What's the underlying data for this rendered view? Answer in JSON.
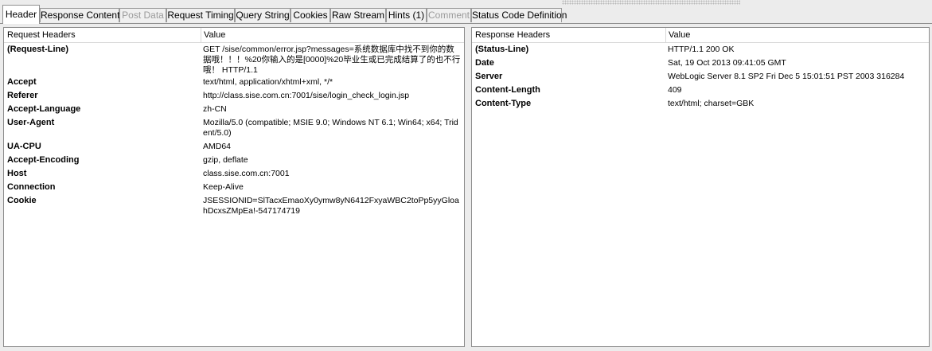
{
  "tabs": [
    {
      "label": "Header",
      "active": true,
      "disabled": false
    },
    {
      "label": "Response Content",
      "active": false,
      "disabled": false
    },
    {
      "label": "Post Data",
      "active": false,
      "disabled": true
    },
    {
      "label": "Request Timing",
      "active": false,
      "disabled": false
    },
    {
      "label": "Query String",
      "active": false,
      "disabled": false
    },
    {
      "label": "Cookies",
      "active": false,
      "disabled": false
    },
    {
      "label": "Raw Stream",
      "active": false,
      "disabled": false
    },
    {
      "label": "Hints (1)",
      "active": false,
      "disabled": false
    },
    {
      "label": "Comment",
      "active": false,
      "disabled": true
    },
    {
      "label": "Status Code Definition",
      "active": false,
      "disabled": false
    }
  ],
  "request": {
    "header_col": "Request Headers",
    "value_col": "Value",
    "rows": [
      {
        "name": "(Request-Line)",
        "value": "GET /sise/common/error.jsp?messages=系统数据库中找不到你的数据哦！！！%20你输入的是[0000]%20毕业生或已完成结算了的也不行哦！ HTTP/1.1"
      },
      {
        "name": "Accept",
        "value": "text/html, application/xhtml+xml, */*"
      },
      {
        "name": "Referer",
        "value": "http://class.sise.com.cn:7001/sise/login_check_login.jsp"
      },
      {
        "name": "Accept-Language",
        "value": "zh-CN"
      },
      {
        "name": "User-Agent",
        "value": "Mozilla/5.0 (compatible; MSIE 9.0; Windows NT 6.1; Win64; x64; Trident/5.0)"
      },
      {
        "name": "UA-CPU",
        "value": "AMD64"
      },
      {
        "name": "Accept-Encoding",
        "value": "gzip, deflate"
      },
      {
        "name": "Host",
        "value": "class.sise.com.cn:7001"
      },
      {
        "name": "Connection",
        "value": "Keep-Alive"
      },
      {
        "name": "Cookie",
        "value": "JSESSIONID=SlTacxEmaoXy0ymw8yN6412FxyaWBC2toPp5yyGloahDcxsZMpEa!-547174719"
      }
    ]
  },
  "response": {
    "header_col": "Response Headers",
    "value_col": "Value",
    "rows": [
      {
        "name": "(Status-Line)",
        "value": "HTTP/1.1 200 OK"
      },
      {
        "name": "Date",
        "value": "Sat, 19 Oct 2013 09:41:05 GMT"
      },
      {
        "name": "Server",
        "value": "WebLogic Server 8.1 SP2 Fri Dec 5 15:01:51 PST 2003 316284"
      },
      {
        "name": "Content-Length",
        "value": "409"
      },
      {
        "name": "Content-Type",
        "value": "text/html; charset=GBK"
      }
    ]
  }
}
